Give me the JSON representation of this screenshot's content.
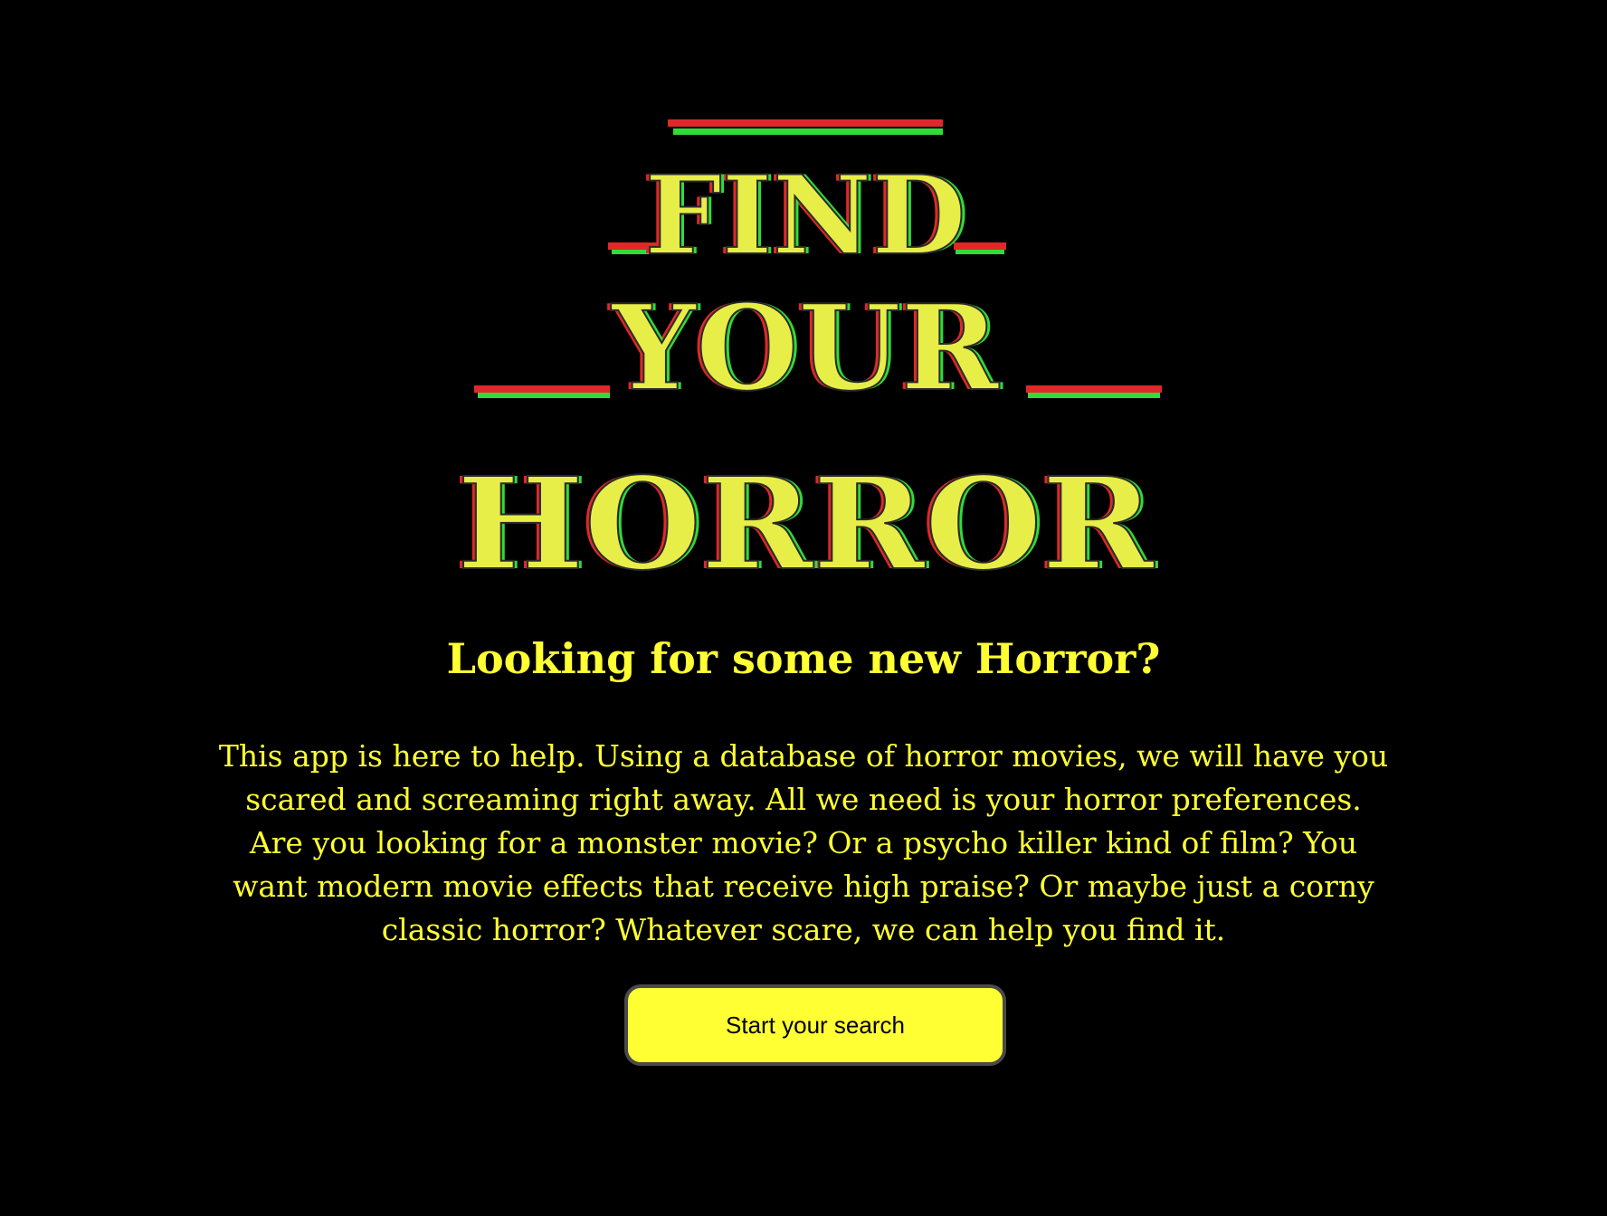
{
  "logo": {
    "line1": "FIND",
    "line2": "YOUR",
    "line3": "HORROR",
    "fill_color": "#e8ee48",
    "shadow_red": "#e02828",
    "shadow_green": "#2edc3a"
  },
  "main": {
    "heading": "Looking for some new Horror?",
    "intro": "This app is here to help. Using a database of horror movies, we will have you scared and screaming right away. All we need is your horror preferences. Are you looking for a monster movie? Or a psycho killer kind of film? You want modern movie effects that receive high praise? Or maybe just a corny classic horror? Whatever scare, we can help you find it.",
    "cta_label": "Start your search"
  },
  "colors": {
    "background": "#000000",
    "accent": "#ffff33",
    "button_border": "#4a4a4a"
  }
}
